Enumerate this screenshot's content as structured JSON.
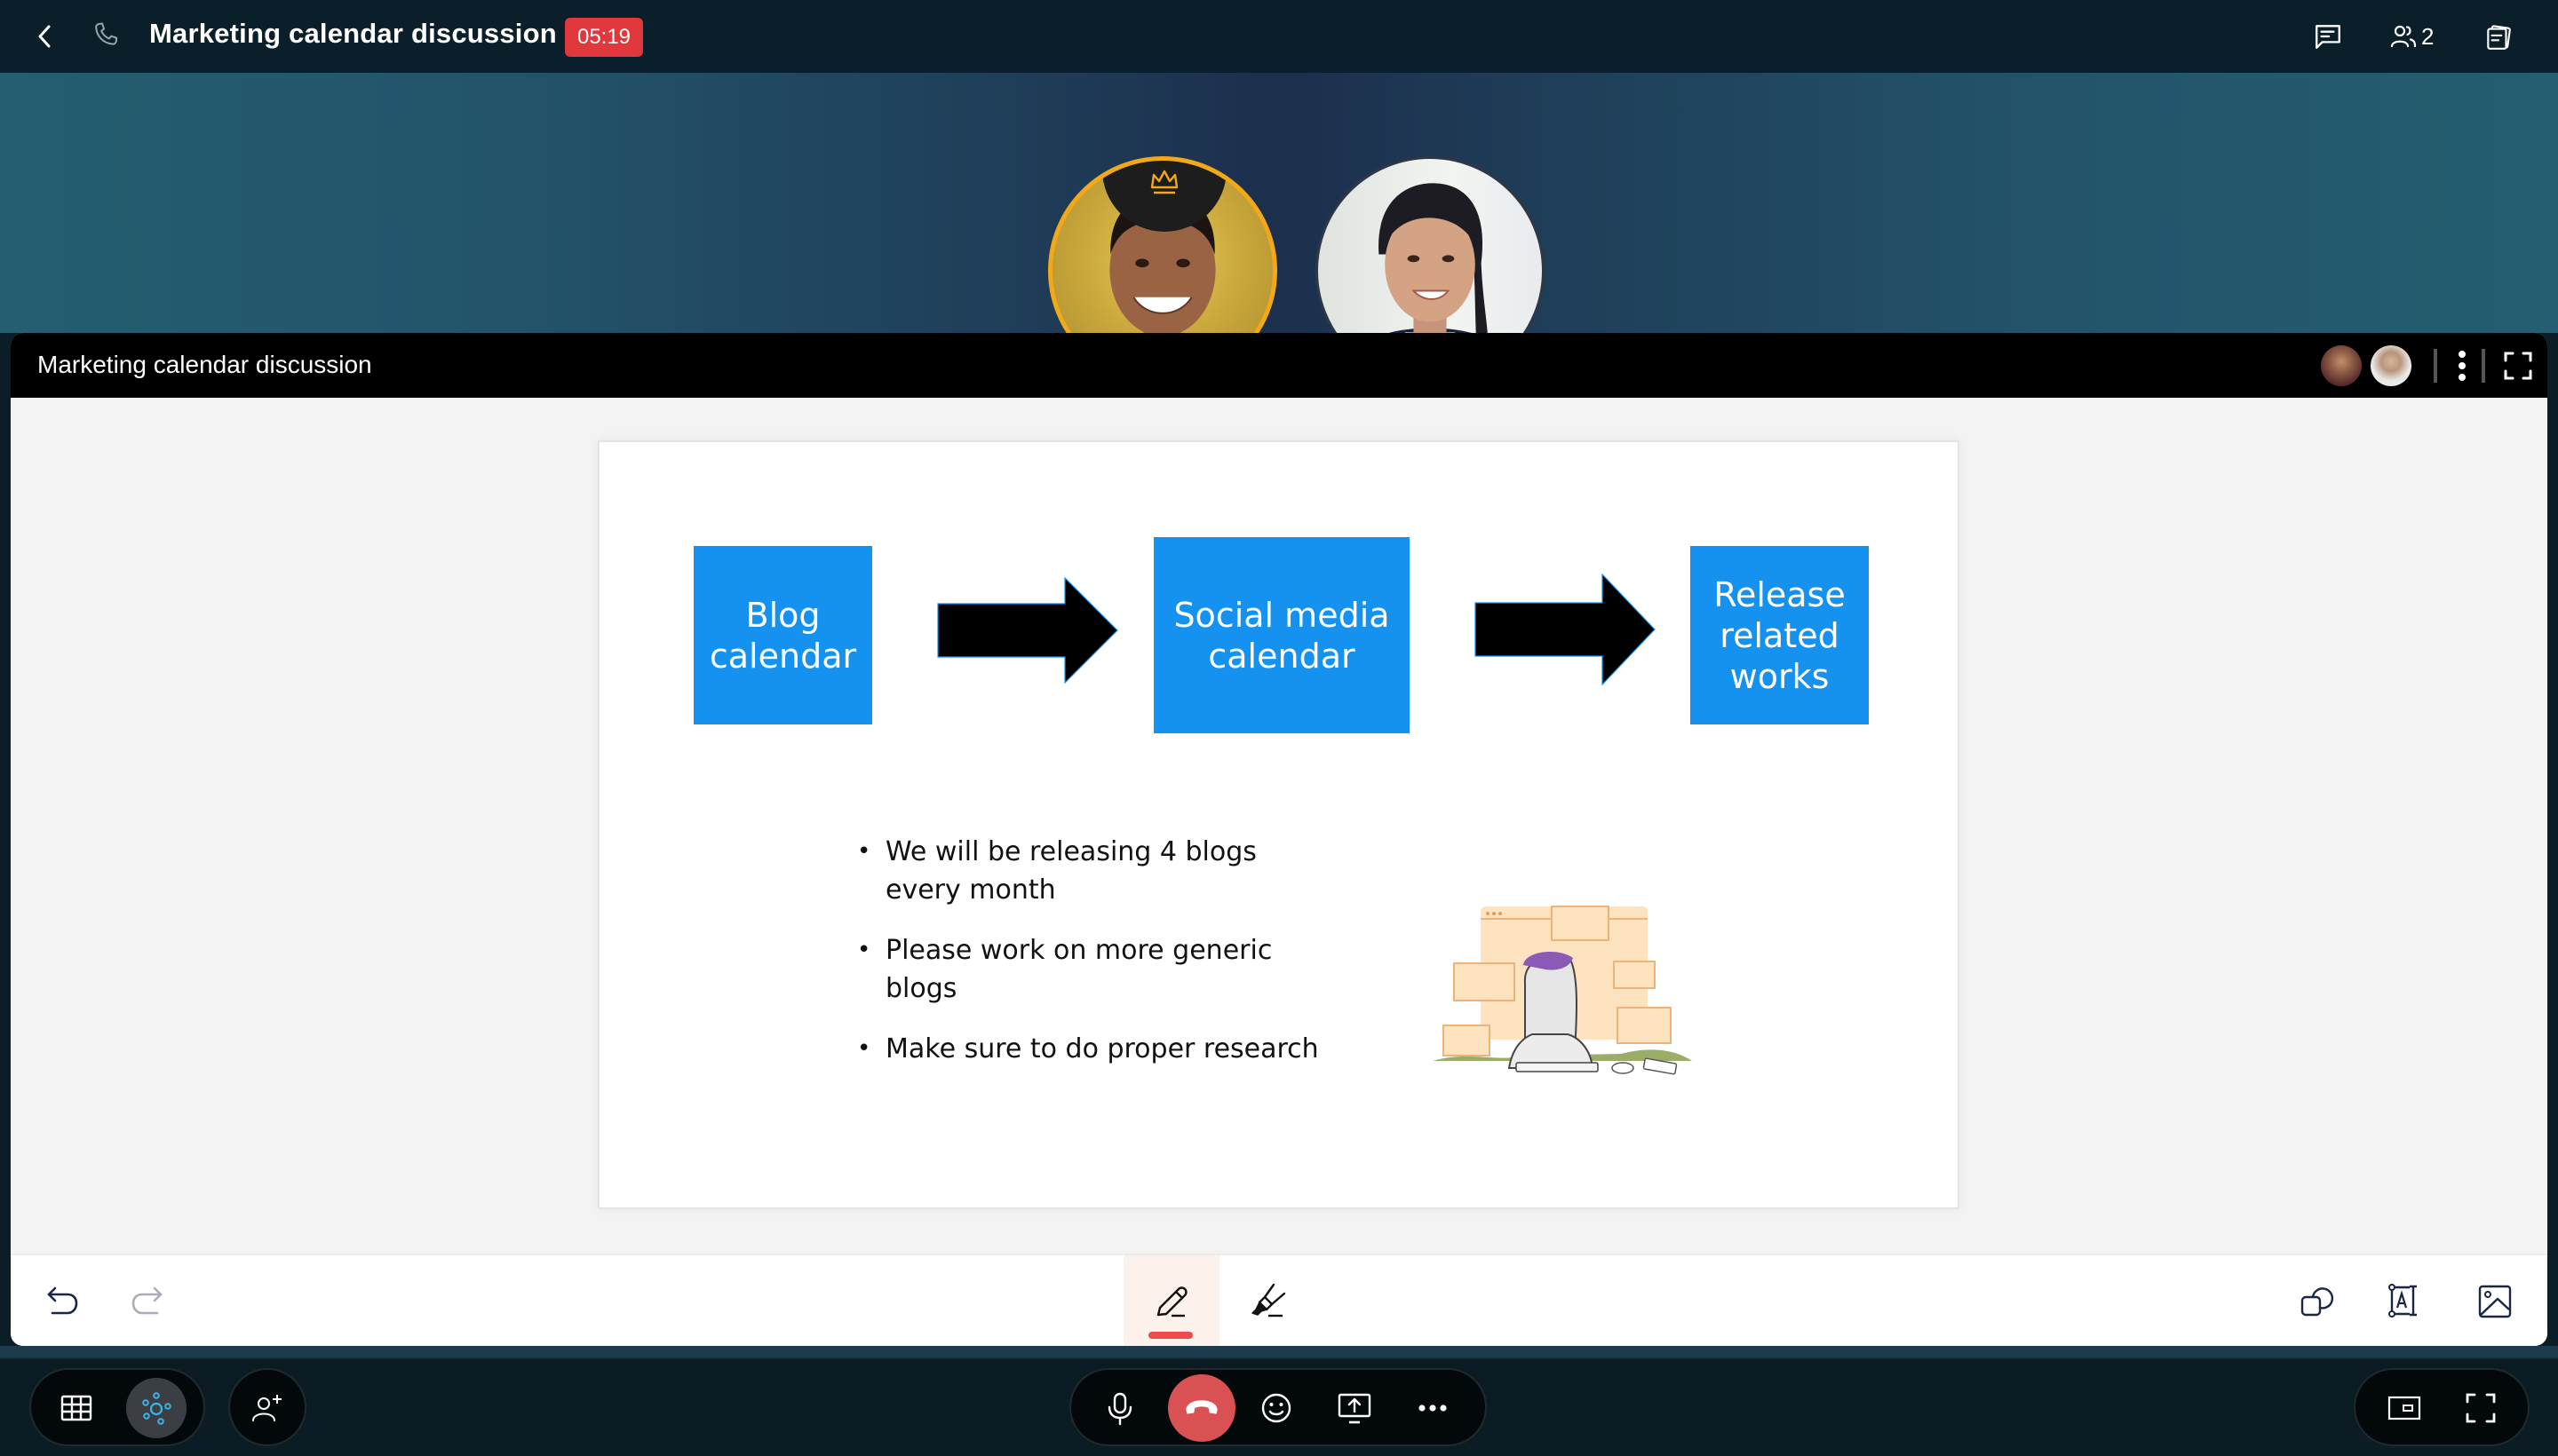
{
  "topbar": {
    "back_icon": "chevron-left-icon",
    "call_icon": "phone-icon",
    "title": "Marketing calendar discussion",
    "timer": "05:19",
    "timer_color": "#e0383c",
    "chat_icon": "chat-icon",
    "participants_icon": "people-icon",
    "participants_count": "2",
    "notes_icon": "notes-stack-icon"
  },
  "participants": [
    {
      "role": "host",
      "badge_icon": "crown-icon",
      "border_color": "#f3a917"
    },
    {
      "role": "guest"
    }
  ],
  "whiteboard": {
    "title": "Marketing calendar discussion",
    "viewer_count": 2,
    "menu_icon": "kebab-menu-icon",
    "expand_icon": "fullscreen-icon",
    "slide": {
      "flow": [
        {
          "label": "Blog calendar"
        },
        {
          "label": "Social media calendar"
        },
        {
          "label": "Release related works"
        }
      ],
      "box_color": "#1592f0",
      "bullets": [
        "We will be releasing 4 blogs every month",
        "Please work on more generic blogs",
        "Make sure to do proper research"
      ],
      "illustration": "person-in-video-call-illustration"
    },
    "toolbar": {
      "undo": "undo-icon",
      "redo": "redo-icon",
      "pen": "pen-icon",
      "pen_active": true,
      "highlighter": "highlighter-icon",
      "shapes": "shapes-icon",
      "textbox": "text-box-icon",
      "image": "image-icon",
      "active_color": "#f04b4b"
    }
  },
  "controls": {
    "layout_grid": "grid-view-icon",
    "layout_focus": "spotlight-view-icon",
    "add_participant": "add-participant-icon",
    "mic": "microphone-icon",
    "end_call": "end-call-icon",
    "end_call_color": "#d95152",
    "reactions": "emoji-icon",
    "share_screen": "share-screen-icon",
    "more": "more-options-icon",
    "pip": "picture-in-picture-icon",
    "fullscreen": "fullscreen-icon"
  }
}
